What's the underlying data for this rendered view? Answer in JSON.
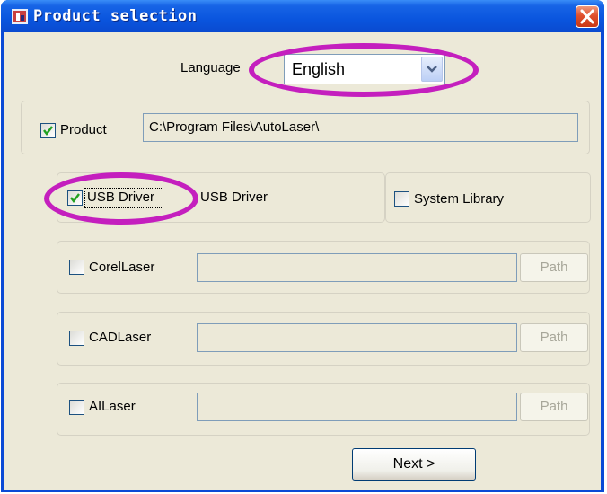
{
  "window": {
    "title": "Product selection"
  },
  "language": {
    "label": "Language",
    "selected": "English"
  },
  "product": {
    "checkbox_label": "Product",
    "checked": true,
    "path": "C:\\Program Files\\AutoLaser\\"
  },
  "usb_driver": {
    "checkbox_label": "USB Driver",
    "checked": true,
    "description": "USB Driver"
  },
  "system_library": {
    "checkbox_label": "System Library",
    "checked": false
  },
  "components": [
    {
      "label": "CorelLaser",
      "checked": false,
      "path": "",
      "path_button": "Path"
    },
    {
      "label": "CADLaser",
      "checked": false,
      "path": "",
      "path_button": "Path"
    },
    {
      "label": "AILaser",
      "checked": false,
      "path": "",
      "path_button": "Path"
    }
  ],
  "next_button": {
    "label": "Next >"
  },
  "colors": {
    "titlebar": "#0a55de",
    "dialog_bg": "#ece9d8",
    "annotation_highlight": "#c41fbe",
    "checkmark": "#21a121"
  },
  "icons": {
    "app": "autolaser-app-icon",
    "close": "close-x-icon",
    "dropdown": "chevron-down-icon",
    "check": "checkmark-icon"
  }
}
